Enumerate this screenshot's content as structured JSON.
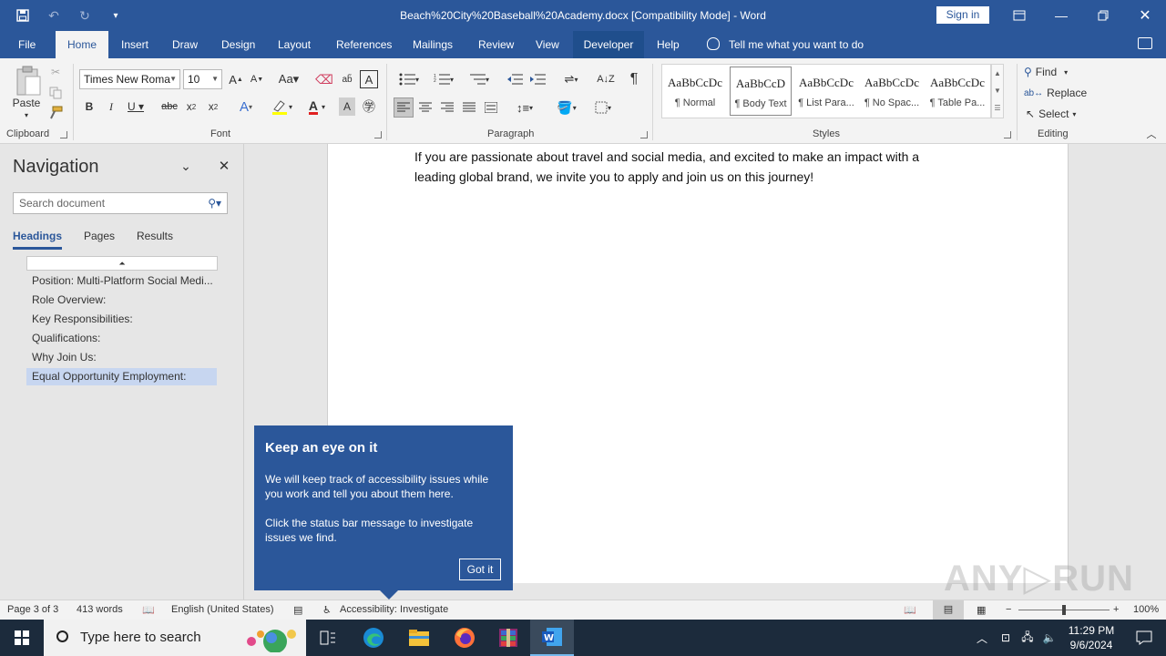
{
  "window": {
    "title": "Beach%20City%20Baseball%20Academy.docx [Compatibility Mode]  -  Word",
    "sign_in": "Sign in"
  },
  "ribbon_tabs": [
    "File",
    "Home",
    "Insert",
    "Draw",
    "Design",
    "Layout",
    "References",
    "Mailings",
    "Review",
    "View",
    "Developer",
    "Help"
  ],
  "active_tab": "Home",
  "tell_me": "Tell me what you want to do",
  "clipboard": {
    "paste_label": "Paste",
    "group_label": "Clipboard"
  },
  "font": {
    "name": "Times New Roma",
    "size": "10",
    "group_label": "Font"
  },
  "paragraph": {
    "group_label": "Paragraph"
  },
  "styles": {
    "group_label": "Styles",
    "items": [
      {
        "preview": "AaBbCcDc",
        "name": "¶ Normal"
      },
      {
        "preview": "AaBbCcD",
        "name": "¶ Body Text"
      },
      {
        "preview": "AaBbCcDc",
        "name": "¶ List Para..."
      },
      {
        "preview": "AaBbCcDc",
        "name": "¶ No Spac..."
      },
      {
        "preview": "AaBbCcDc",
        "name": "¶ Table Pa..."
      }
    ]
  },
  "editing": {
    "find": "Find",
    "replace": "Replace",
    "select": "Select",
    "group_label": "Editing"
  },
  "navigation": {
    "title": "Navigation",
    "search_placeholder": "Search document",
    "tabs": [
      "Headings",
      "Pages",
      "Results"
    ],
    "headings": [
      "Position: Multi-Platform Social Medi...",
      "Role Overview:",
      "Key Responsibilities:",
      "Qualifications:",
      "Why Join Us:",
      "Equal Opportunity Employment:"
    ]
  },
  "document": {
    "text_line1": "If you are passionate about travel and social media, and excited to make an impact with a",
    "text_line2": "leading global brand, we invite you to apply and join us on this journey!"
  },
  "callout": {
    "title": "Keep an eye on it",
    "para1": "We will keep track of accessibility issues while you work and tell you about them here.",
    "para2": "Click the status bar message to investigate issues we find.",
    "button": "Got it"
  },
  "status": {
    "page": "Page 3 of 3",
    "words": "413 words",
    "language": "English (United States)",
    "accessibility": "Accessibility: Investigate",
    "zoom": "100%"
  },
  "taskbar": {
    "search_placeholder": "Type here to search",
    "time": "11:29 PM",
    "date": "9/6/2024"
  },
  "watermark": "ANY RUN",
  "colors": {
    "accent": "#2b579a",
    "taskbar": "#1c2b3c"
  }
}
